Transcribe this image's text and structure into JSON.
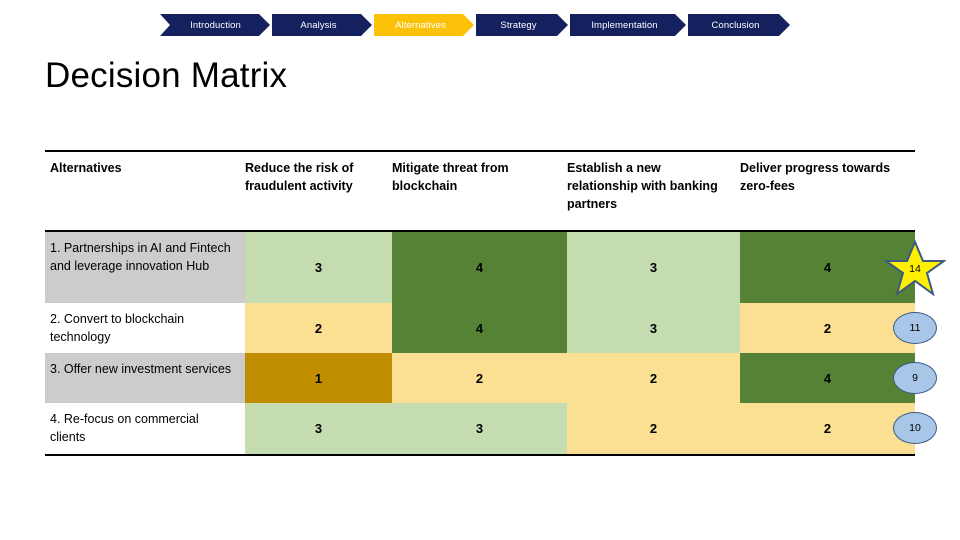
{
  "nav": {
    "items": [
      {
        "label": "Introduction",
        "active": false,
        "width": 110
      },
      {
        "label": "Analysis",
        "active": false,
        "width": 100
      },
      {
        "label": "Alternatives",
        "active": true,
        "width": 100
      },
      {
        "label": "Strategy",
        "active": false,
        "width": 92
      },
      {
        "label": "Implementation",
        "active": false,
        "width": 116
      },
      {
        "label": "Conclusion",
        "active": false,
        "width": 102
      }
    ],
    "colors": {
      "inactive": "#15215e",
      "active": "#fcc20a",
      "text": "#ffffff"
    }
  },
  "title": "Decision Matrix",
  "table": {
    "headers": [
      "Alternatives",
      "Reduce the risk of fraudulent activity",
      "Mitigate threat from blockchain",
      "Establish a new relationship with banking partners",
      "Deliver progress towards zero-fees"
    ],
    "rows": [
      {
        "label": "1. Partnerships in AI and Fintech and leverage innovation Hub",
        "label_bg": "#cccccc",
        "scores": [
          "3",
          "4",
          "3",
          "4"
        ],
        "score_bg": [
          "#c5dcb0",
          "#558234",
          "#c5dcb0",
          "#558234"
        ],
        "total": "14",
        "badge": "star"
      },
      {
        "label": "2. Convert to blockchain technology",
        "label_bg": "#ffffff",
        "scores": [
          "2",
          "4",
          "3",
          "2"
        ],
        "score_bg": [
          "#fbdf93",
          "#558234",
          "#c5dcb0",
          "#fbdf93"
        ],
        "total": "11",
        "badge": "oval"
      },
      {
        "label": "3. Offer new investment services",
        "label_bg": "#cccccc",
        "scores": [
          "1",
          "2",
          "2",
          "4"
        ],
        "score_bg": [
          "#c08c00",
          "#fbdf93",
          "#fbdf93",
          "#558234"
        ],
        "total": "9",
        "badge": "oval"
      },
      {
        "label": "4. Re-focus on commercial clients",
        "label_bg": "#ffffff",
        "scores": [
          "3",
          "3",
          "2",
          "2"
        ],
        "score_bg": [
          "#c5dcb0",
          "#c5dcb0",
          "#fbdf93",
          "#fbdf93"
        ],
        "total": "10",
        "badge": "oval"
      }
    ],
    "badge_colors": {
      "oval_fill": "#a8c6e8",
      "oval_stroke": "#3c5a82",
      "star_fill": "#ffef00",
      "star_stroke": "#3c5a82"
    }
  }
}
